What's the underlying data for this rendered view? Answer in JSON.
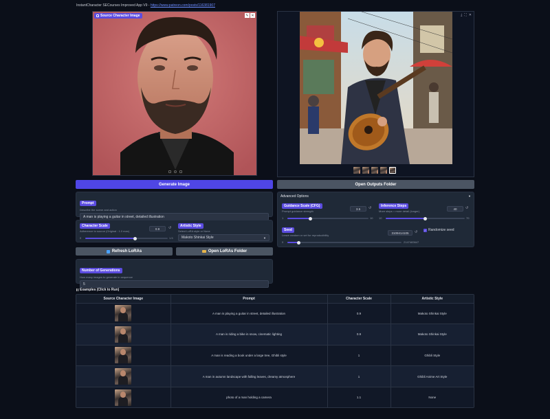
{
  "app": {
    "title_text": "InstantCharacter SECourses Improved App V9 - ",
    "title_link": "https://www.patreon.com/posts/116381907"
  },
  "source_panel": {
    "label": "Source Character Image"
  },
  "buttons": {
    "generate": "Generate Image",
    "open_outputs": "Open Outputs Folder",
    "refresh_loras": "Refresh LoRAs",
    "open_loras": "Open LoRAs Folder"
  },
  "prompt": {
    "label": "Prompt",
    "sub": "Describe the scene and action",
    "value": "A man is playing a guitar in street, detailed illustration"
  },
  "character_scale": {
    "label": "Character Scale",
    "sub": "Adherence to source (Original : 1.0 max)",
    "value": "0.9",
    "min": "0",
    "max": "1.5",
    "fraction": 0.6
  },
  "artistic_style": {
    "label": "Artistic Style",
    "sub": "Select LoRA style or None",
    "value": "Makoto Shinkai Style"
  },
  "generations": {
    "label": "Number of Generations",
    "sub": "How many images to generate in sequence",
    "value": "5"
  },
  "advanced": {
    "title": "Advanced Options",
    "guidance": {
      "label": "Guidance Scale (CFG)",
      "sub": "Prompt guidance strength",
      "value": "3.5",
      "min": "1",
      "max": "10",
      "fraction": 0.28
    },
    "steps": {
      "label": "Inference Steps",
      "sub": "More steps = more detail (longer)",
      "value": "40",
      "min": "10",
      "max": "70",
      "fraction": 0.5
    },
    "seed": {
      "label": "Seed",
      "sub": "Leave random or set for reproducibility",
      "value": "3109414105",
      "min": "0",
      "max": "2147483647",
      "fraction": 0.1
    },
    "randomize": "Randomize seed"
  },
  "examples": {
    "header": "Examples (Click to Run)",
    "columns": [
      "Source Character Image",
      "Prompt",
      "Character Scale",
      "Artistic Style"
    ],
    "rows": [
      {
        "prompt": "A man is playing a guitar in street, detailed illustration",
        "scale": "0.9",
        "style": "Makoto Shinkai Style"
      },
      {
        "prompt": "A man is riding a bike in snow, cinematic lighting",
        "scale": "0.9",
        "style": "Makoto Shinkai Style"
      },
      {
        "prompt": "A man is reading a book under a large tree, Ghibli style",
        "scale": "1",
        "style": "Ghibli Style"
      },
      {
        "prompt": "A man in autumn landscape with falling leaves, dreamy atmosphere",
        "scale": "1",
        "style": "Ghibli Anime Art Style"
      },
      {
        "prompt": "photo of a man holding a camera",
        "scale": "1.1",
        "style": "None"
      }
    ]
  }
}
